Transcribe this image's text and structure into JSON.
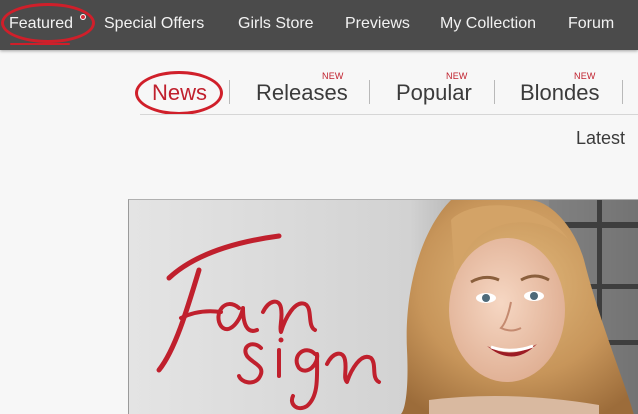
{
  "top_nav": {
    "items": [
      {
        "label": "Featured"
      },
      {
        "label": "Special Offers"
      },
      {
        "label": "Girls Store"
      },
      {
        "label": "Previews"
      },
      {
        "label": "My Collection"
      },
      {
        "label": "Forum"
      }
    ]
  },
  "sub_nav": {
    "tabs": [
      {
        "label": "News",
        "badge": ""
      },
      {
        "label": "Releases",
        "badge": "NEW"
      },
      {
        "label": "Popular",
        "badge": "NEW"
      },
      {
        "label": "Blondes",
        "badge": "NEW"
      }
    ]
  },
  "sort_label": "Latest",
  "banner": {
    "title_line1": "Fan",
    "title_line2": "sign"
  },
  "colors": {
    "nav_bg": "#4b4b4b",
    "accent_red": "#c0202d",
    "annotation_red": "#d01f2a",
    "page_bg": "#f7f7f7"
  }
}
